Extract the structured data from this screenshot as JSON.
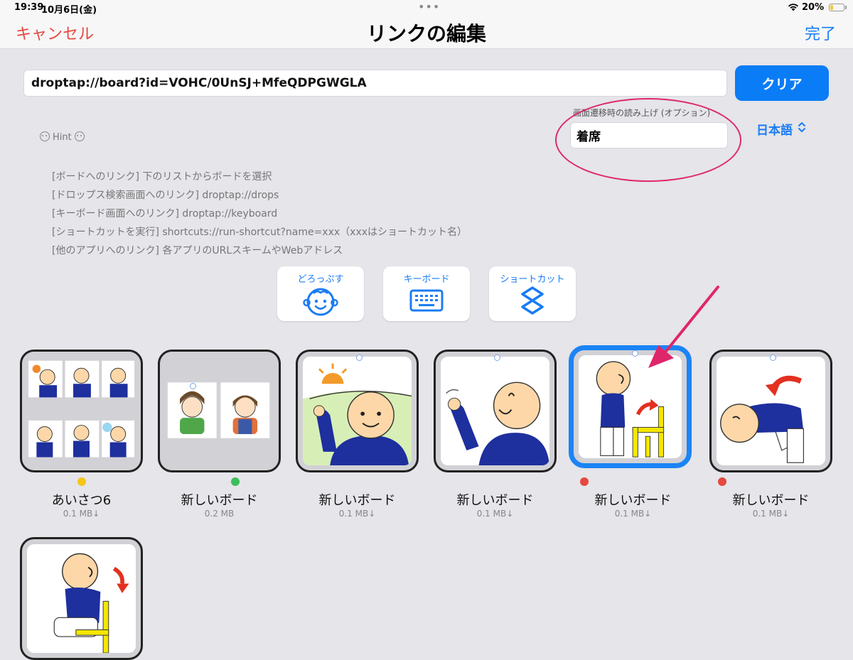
{
  "status": {
    "time": "19:39",
    "date": "10月6日(金)",
    "battery": "20%",
    "battery_level": 0.2,
    "battery_color": "#f2c744"
  },
  "nav": {
    "cancel": "キャンセル",
    "title": "リンクの編集",
    "done": "完了"
  },
  "url": {
    "value": "droptap://board?id=VOHC/0UnSJ+MfeQDPGWGLA",
    "clear_label": "クリア"
  },
  "speech": {
    "label": "画面遷移時の読み上げ (オプション)",
    "value": "着席",
    "language": "日本語"
  },
  "hint": {
    "title": "Hint",
    "lines": [
      "[ボードへのリンク] 下のリストからボードを選択",
      "[ドロップス検索画面へのリンク] droptap://drops",
      "[キーボード画面へのリンク] droptap://keyboard",
      "[ショートカットを実行] shortcuts://run-shortcut?name=xxx（xxxはショートカット名）",
      "[他のアプリへのリンク] 各アプリのURLスキームやWebアドレス"
    ]
  },
  "shortcuts": [
    {
      "label": "どろっぷす",
      "icon": "face-icon"
    },
    {
      "label": "キーボード",
      "icon": "keyboard-icon"
    },
    {
      "label": "ショートカット",
      "icon": "shortcuts-icon"
    }
  ],
  "boards": [
    {
      "name": "あいさつ6",
      "size": "0.1 MB↓",
      "status_color": "#f5c518",
      "selected": false
    },
    {
      "name": "新しいボード",
      "size": "0.2 MB",
      "status_color": "#3cbf5a",
      "selected": false
    },
    {
      "name": "新しいボード",
      "size": "0.1 MB↓",
      "status_color": "",
      "selected": false
    },
    {
      "name": "新しいボード",
      "size": "0.1 MB↓",
      "status_color": "",
      "selected": false
    },
    {
      "name": "新しいボード",
      "size": "0.1 MB↓",
      "status_color": "#e5483e",
      "selected": true
    },
    {
      "name": "新しいボード",
      "size": "0.1 MB↓",
      "status_color": "#e5483e",
      "selected": false
    },
    {
      "name": "",
      "size": "",
      "status_color": "",
      "selected": false
    }
  ],
  "colors": {
    "accent": "#0a7cf5",
    "destructive": "#e5483e",
    "annotation": "#e0266b"
  }
}
